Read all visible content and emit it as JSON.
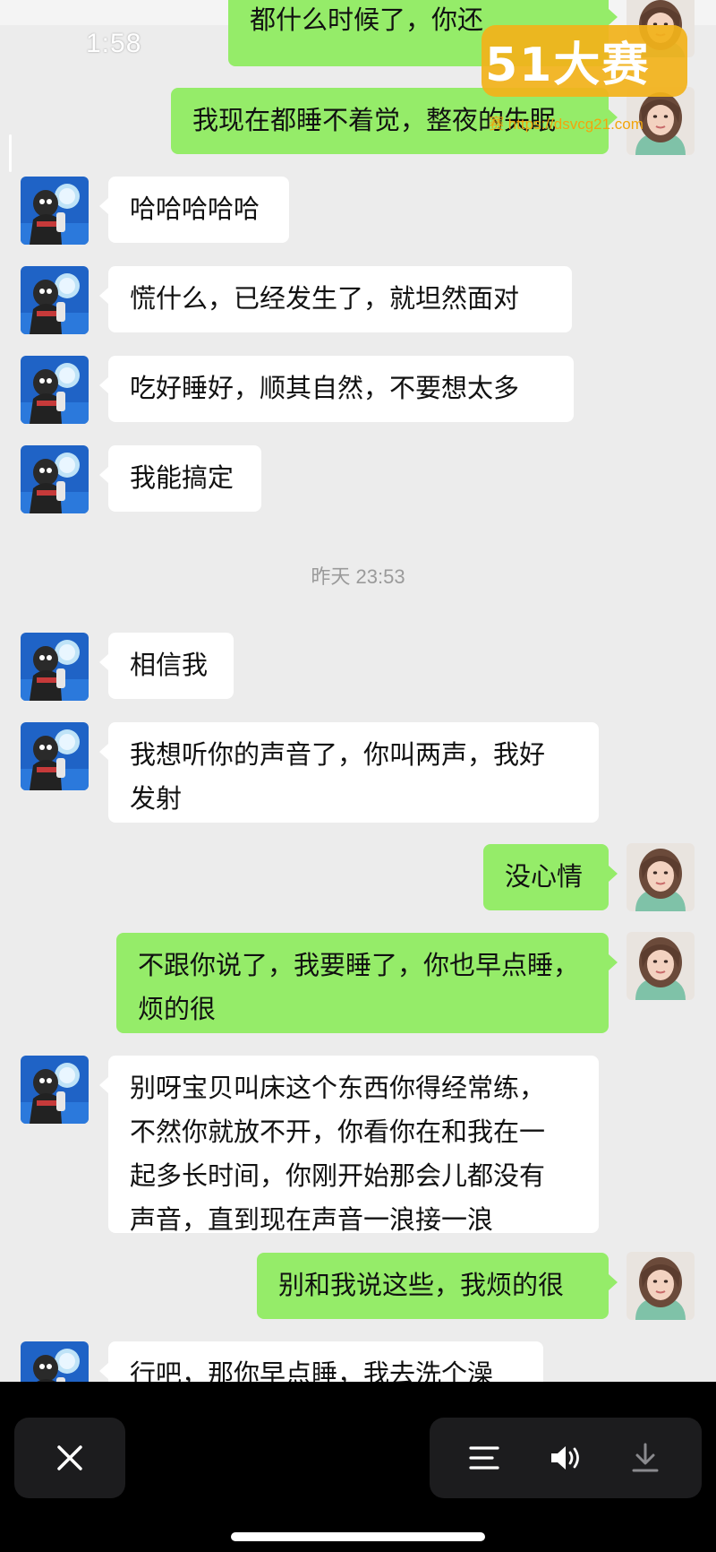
{
  "status_bar": {
    "time": "1:58"
  },
  "watermark": {
    "logo": "51大赛",
    "url": "赛 https://dsvcg21.com"
  },
  "timestamp": "昨天 23:53",
  "messages": [
    {
      "side": "out",
      "text": "都什么时候了，你还"
    },
    {
      "side": "out",
      "text": "我现在都睡不着觉，整夜的失眠"
    },
    {
      "side": "in",
      "text": "哈哈哈哈哈"
    },
    {
      "side": "in",
      "text": "慌什么，已经发生了，就坦然面对"
    },
    {
      "side": "in",
      "text": "吃好睡好，顺其自然，不要想太多"
    },
    {
      "side": "in",
      "text": "我能搞定"
    },
    {
      "side": "in",
      "text": "相信我"
    },
    {
      "side": "in",
      "text": "我想听你的声音了，你叫两声，我好\n发射"
    },
    {
      "side": "out",
      "text": "没心情"
    },
    {
      "side": "out",
      "text": "不跟你说了，我要睡了，你也早点睡，\n烦的很"
    },
    {
      "side": "in",
      "text": "别呀宝贝叫床这个东西你得经常练，\n不然你就放不开，你看你在和我在一\n起多长时间，你刚开始那会儿都没有\n声音，直到现在声音一浪接一浪"
    },
    {
      "side": "out",
      "text": "别和我说这些，我烦的很"
    },
    {
      "side": "in",
      "text": "行吧，那你早点睡，我去洗个澡"
    }
  ],
  "controls": {
    "close": "close-icon",
    "menu": "list-icon",
    "volume": "speaker-icon",
    "download": "download-icon"
  }
}
